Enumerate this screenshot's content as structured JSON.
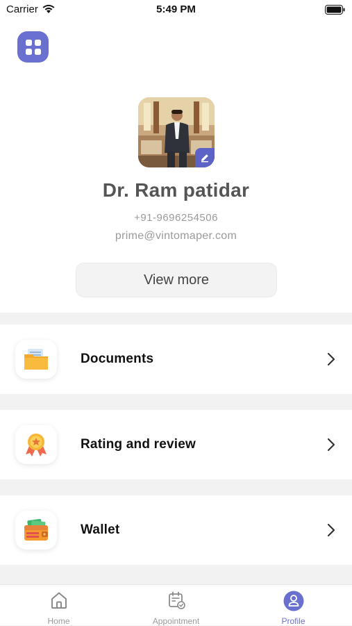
{
  "status_bar": {
    "carrier": "Carrier",
    "time": "5:49 PM"
  },
  "profile": {
    "name": "Dr. Ram patidar",
    "phone": "+91-9696254506",
    "email": "prime@vintomaper.com",
    "view_more_label": "View more"
  },
  "menu": {
    "items": [
      {
        "label": "Documents",
        "icon": "folder-icon"
      },
      {
        "label": "Rating and review",
        "icon": "award-badge-icon"
      },
      {
        "label": "Wallet",
        "icon": "wallet-icon"
      }
    ]
  },
  "tabbar": {
    "tabs": [
      {
        "label": "Home",
        "icon": "home-icon"
      },
      {
        "label": "Appointment",
        "icon": "calendar-check-icon"
      },
      {
        "label": "Profile",
        "icon": "profile-icon",
        "active": true
      }
    ]
  },
  "colors": {
    "accent": "#6a70cf",
    "background": "#f2f2f2",
    "card": "#ffffff"
  }
}
